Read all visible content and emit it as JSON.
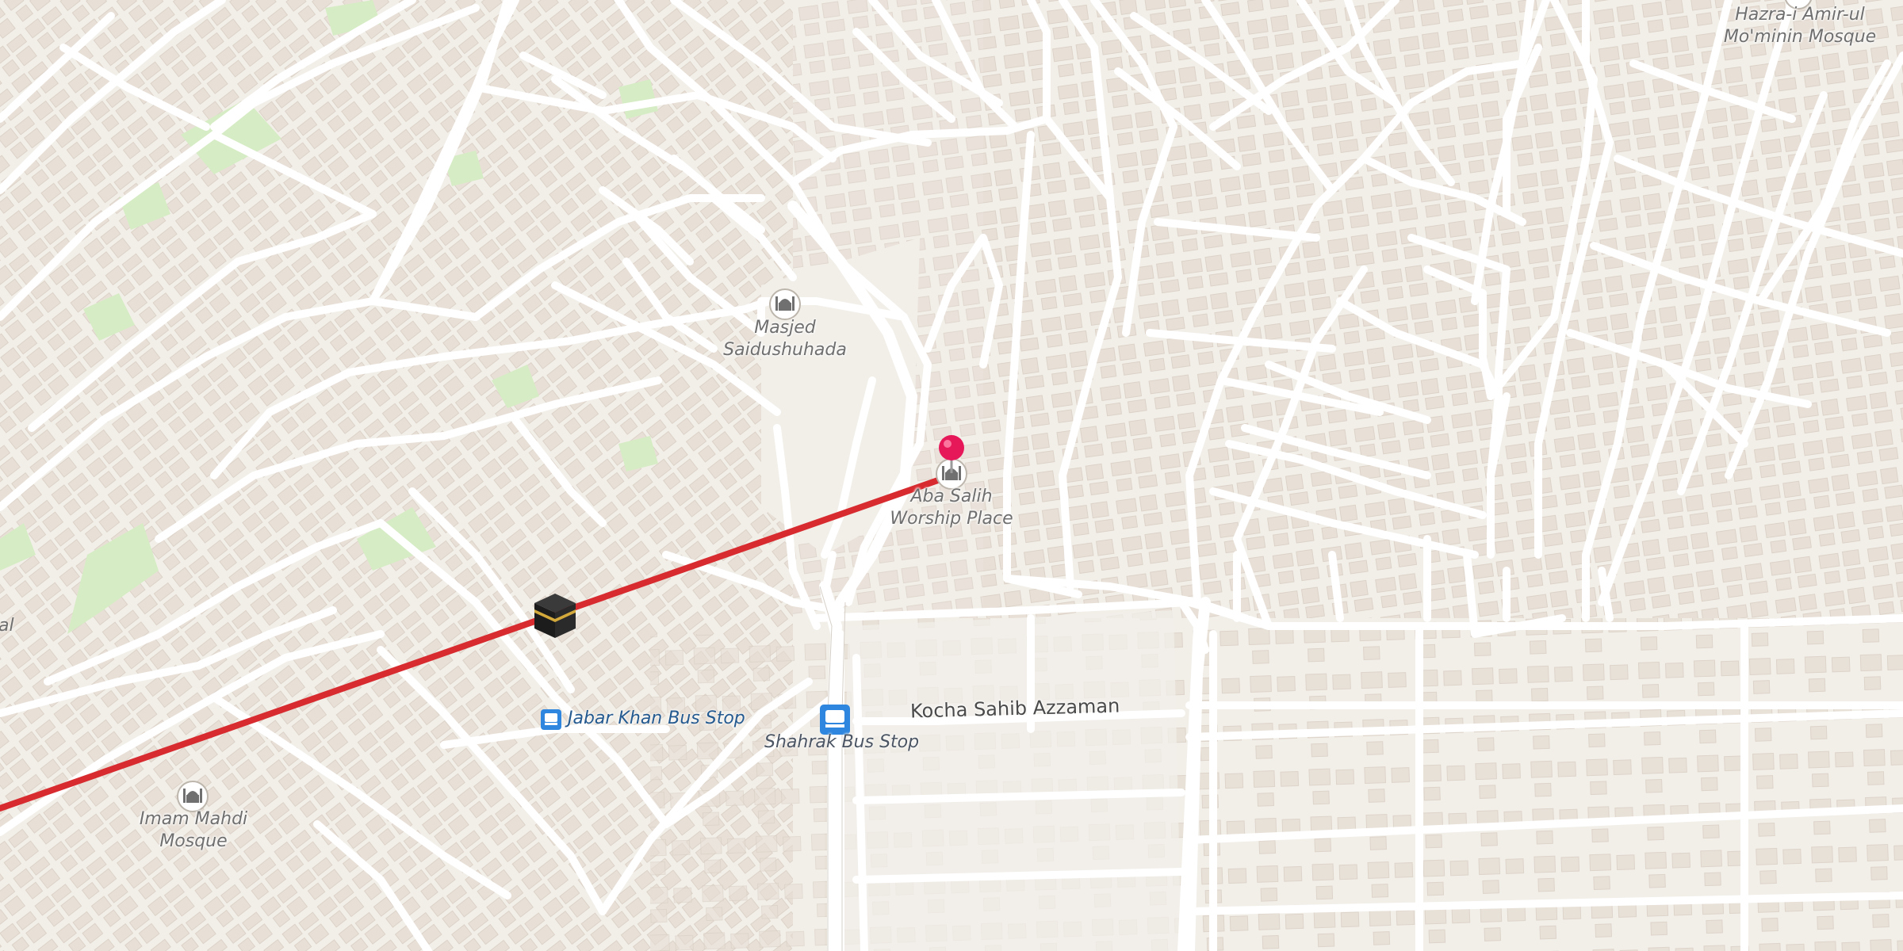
{
  "map": {
    "background_color": "#f2efe9",
    "road_color": "#ffffff",
    "building_color": "#e6ddd4",
    "park_color": "#d6ecc4",
    "route_color": "#d72b30",
    "pin_color": "#e6185a"
  },
  "pois": [
    {
      "id": "masjed",
      "line1": "Masjed",
      "line2": "Saidushuhada",
      "icon": "mosque-icon"
    },
    {
      "id": "aba",
      "line1": "Aba Salih",
      "line2": "Worship Place",
      "icon": "mosque-icon"
    },
    {
      "id": "imam",
      "line1": "Imam Mahdi",
      "line2": "Mosque",
      "icon": "mosque-icon"
    },
    {
      "id": "hazra",
      "line1": "Hazra-i Amir-ul",
      "line2": "Mo'minin Mosque",
      "icon": "mosque-icon"
    }
  ],
  "bus_stops": {
    "jabar": "Jabar Khan Bus Stop",
    "shahrak": "Shahrak Bus Stop"
  },
  "streets": {
    "kocha": "Kocha Sahib Azzaman"
  },
  "edge_text": "al",
  "markers": {
    "destination": "map-pin-icon",
    "origin": "kaaba-icon"
  }
}
